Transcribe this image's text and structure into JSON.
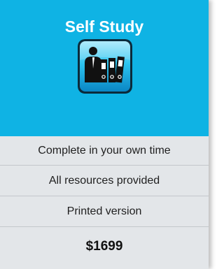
{
  "plan": {
    "title": "Self Study",
    "icon": "person-with-binders-icon",
    "features": [
      "Complete in your own time",
      "All resources provided",
      "Printed version"
    ],
    "price": "$1699"
  },
  "colors": {
    "header_bg": "#0fb3e4",
    "body_bg": "#e3e6e9",
    "title_text": "#ffffff",
    "price_text": "#111111"
  }
}
